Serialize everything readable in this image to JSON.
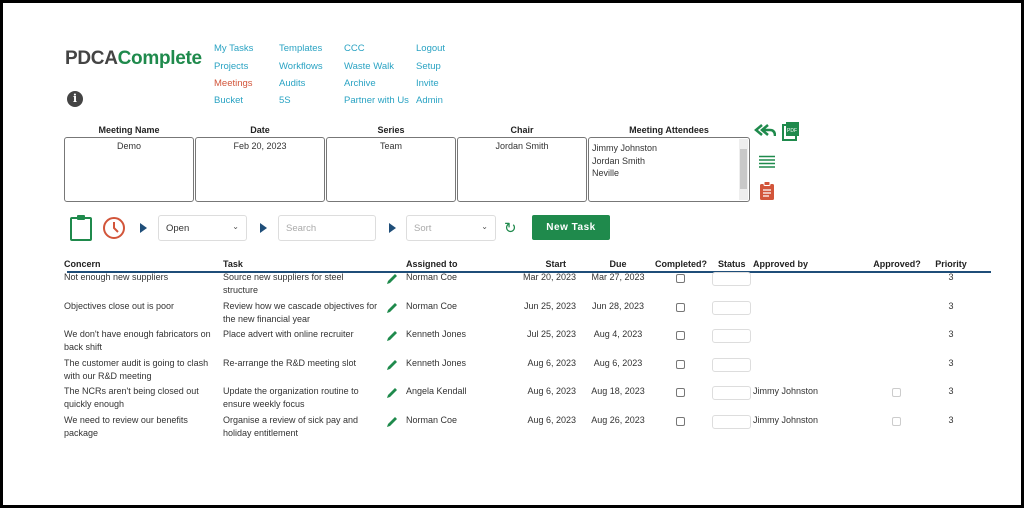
{
  "logo": {
    "part1": "PDCA",
    "part2": "Complete"
  },
  "nav": [
    {
      "label": "My Tasks",
      "active": false
    },
    {
      "label": "Projects",
      "active": false
    },
    {
      "label": "Meetings",
      "active": true
    },
    {
      "label": "Bucket",
      "active": false
    },
    {
      "label": "Templates",
      "active": false
    },
    {
      "label": "Workflows",
      "active": false
    },
    {
      "label": "Audits",
      "active": false
    },
    {
      "label": "5S",
      "active": false
    },
    {
      "label": "CCC",
      "active": false
    },
    {
      "label": "Waste Walk",
      "active": false
    },
    {
      "label": "Archive",
      "active": false
    },
    {
      "label": "Partner with Us",
      "active": false
    },
    {
      "label": "Logout",
      "active": false
    },
    {
      "label": "Setup",
      "active": false
    },
    {
      "label": "Invite",
      "active": false
    },
    {
      "label": "Admin",
      "active": false
    }
  ],
  "meeting": {
    "name_label": "Meeting Name",
    "name": "Demo",
    "date_label": "Date",
    "date": "Feb 20, 2023",
    "series_label": "Series",
    "series": "Team",
    "chair_label": "Chair",
    "chair": "Jordan Smith",
    "attendees_label": "Meeting Attendees",
    "attendees": [
      "Jimmy Johnston",
      "Jordan Smith",
      "Neville"
    ]
  },
  "side_icons": [
    "reply-all-icon",
    "pdf-icon",
    "list-icon",
    "clipboard-icon"
  ],
  "toolbar": {
    "filter": "Open",
    "search_placeholder": "Search",
    "sort_placeholder": "Sort",
    "new_task": "New Task"
  },
  "table": {
    "headers": {
      "concern": "Concern",
      "task": "Task",
      "assigned": "Assigned to",
      "start": "Start",
      "due": "Due",
      "completed": "Completed?",
      "status": "Status",
      "approved_by": "Approved by",
      "approved": "Approved?",
      "priority": "Priority"
    },
    "rows": [
      {
        "concern": "Not enough new suppliers",
        "task": "Source new suppliers for steel structure",
        "assigned": "Norman Coe",
        "start": "Mar 20, 2023",
        "due": "Mar 27, 2023",
        "completed": false,
        "approved_by": "",
        "approved": null,
        "priority": "3"
      },
      {
        "concern": "Objectives close out is poor",
        "task": "Review how we cascade objectives for the new financial year",
        "assigned": "Norman Coe",
        "start": "Jun 25, 2023",
        "due": "Jun 28, 2023",
        "completed": false,
        "approved_by": "",
        "approved": null,
        "priority": "3"
      },
      {
        "concern": "We don't have enough fabricators on back shift",
        "task": "Place advert with online recruiter",
        "assigned": "Kenneth Jones",
        "start": "Jul 25, 2023",
        "due": "Aug 4, 2023",
        "completed": false,
        "approved_by": "",
        "approved": null,
        "priority": "3"
      },
      {
        "concern": "The customer audit is going to clash with our R&D meeting",
        "task": "Re-arrange the R&D meeting slot",
        "assigned": "Kenneth Jones",
        "start": "Aug 6, 2023",
        "due": "Aug 6, 2023",
        "completed": false,
        "approved_by": "",
        "approved": null,
        "priority": "3"
      },
      {
        "concern": "The NCRs aren't being closed out quickly enough",
        "task": "Update the organization routine to ensure weekly focus",
        "assigned": "Angela Kendall",
        "start": "Aug 6, 2023",
        "due": "Aug 18, 2023",
        "completed": false,
        "approved_by": "Jimmy Johnston",
        "approved": false,
        "priority": "3"
      },
      {
        "concern": "We need to review our benefits package",
        "task": "Organise a review of sick pay and holiday entitlement",
        "assigned": "Norman Coe",
        "start": "Aug 6, 2023",
        "due": "Aug 26, 2023",
        "completed": false,
        "approved_by": "Jimmy Johnston",
        "approved": false,
        "priority": "3"
      }
    ]
  },
  "colors": {
    "brand_green": "#1f8a4c",
    "nav_link": "#2aa3c3",
    "nav_active": "#d2553a",
    "header_rule": "#1f4e79"
  }
}
